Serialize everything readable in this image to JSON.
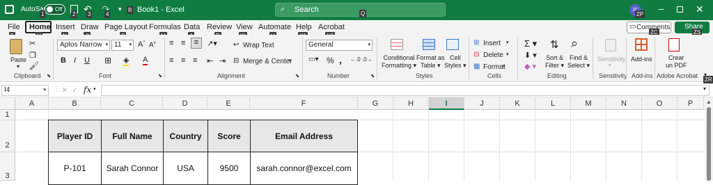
{
  "titlebar": {
    "autosave_label": "AutoSave",
    "toggle_state": "Off",
    "file_title": "Book1 - Excel",
    "search_placeholder": "Search",
    "avatar_initials": "JC"
  },
  "menu": [
    "File",
    "Home",
    "Insert",
    "Draw",
    "Page Layout",
    "Formulas",
    "Data",
    "Review",
    "View",
    "Automate",
    "Help",
    "Acrobat"
  ],
  "comments_label": "Comments",
  "share_label": "Share",
  "keytips": {
    "autosave": "1",
    "save": "2",
    "undo": "3",
    "redo": "4",
    "book": "B",
    "search": "Q",
    "profile": "ZP",
    "file": "F",
    "home": "H",
    "insert": "N",
    "draw": "JI",
    "pagelayout": "P",
    "formulas": "M",
    "data": "A",
    "review": "R",
    "view": "W",
    "automate": "U",
    "help": "Y1",
    "acrobat": "Y2",
    "comments": "ZC",
    "share": "ZS",
    "ribbon": "ZR"
  },
  "ribbon": {
    "clipboard": {
      "paste": "Paste",
      "group": "Clipboard"
    },
    "font": {
      "name": "Aptos Narrow",
      "size": "11",
      "group": "Font"
    },
    "alignment": {
      "wrap": "Wrap Text",
      "merge": "Merge & Center",
      "group": "Alignment"
    },
    "number": {
      "format": "General",
      "group": "Number"
    },
    "styles": {
      "cond": [
        "Conditional",
        "Formatting"
      ],
      "table": [
        "Format as",
        "Table"
      ],
      "cell": [
        "Cell",
        "Styles"
      ],
      "group": "Styles"
    },
    "cells": {
      "insert": "Insert",
      "delete": "Delete",
      "format": "Format",
      "group": "Cells"
    },
    "editing": {
      "sort": [
        "Sort &",
        "Filter"
      ],
      "find": [
        "Find &",
        "Select"
      ],
      "group": "Editing"
    },
    "sensitivity": {
      "label": "Sensitivity",
      "group": "Sensitivity"
    },
    "addins": {
      "label": "Add-ins",
      "group": "Add-ins"
    },
    "acrobat": {
      "label": [
        "Crear",
        "un PDF"
      ],
      "group": "Adobe Acrobat"
    }
  },
  "namebox": "I4",
  "columns": [
    "A",
    "B",
    "C",
    "D",
    "E",
    "F",
    "G",
    "H",
    "I",
    "J",
    "K",
    "L",
    "M",
    "N",
    "O",
    "P"
  ],
  "rows": [
    "1",
    "2",
    "3"
  ],
  "table": {
    "headers": [
      "Player ID",
      "Full Name",
      "Country",
      "Score",
      "Email Address"
    ],
    "row": [
      "P-101",
      "Sarah Connor",
      "USA",
      "9500",
      "sarah.connor@excel.com"
    ]
  },
  "colors": {
    "accent": "#107c41"
  }
}
